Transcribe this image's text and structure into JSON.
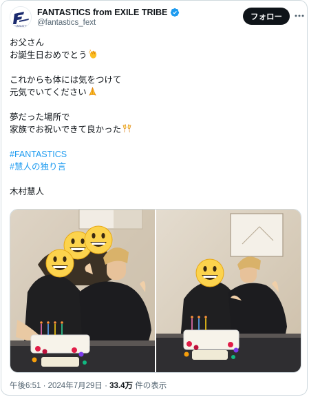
{
  "tweet": {
    "author": {
      "display_name": "FANTASTICS from EXILE TRIBE",
      "handle": "@fantastics_fext",
      "avatar_icon": "fantastics-logo-icon",
      "verified_icon": "verified-badge-icon",
      "verified_color": "#1d9bf0"
    },
    "follow_label": "フォロー",
    "more_icon": "more-dots-icon",
    "text": {
      "line1": "お父さん",
      "line2": "お誕生日おめでとう",
      "line2_emoji": "clapping-hands-icon",
      "line3": "これからも体には気をつけて",
      "line4": "元気でいてください",
      "line4_emoji": "folded-hands-icon",
      "line5": "夢だった場所で",
      "line6": "家族でお祝いできて良かった",
      "line6_emoji": "clinking-glasses-icon",
      "hashtag1": "#FANTASTICS",
      "hashtag2": "#慧人の独り言",
      "signature": "木村慧人"
    },
    "media": {
      "photo1_icon": "family-dinner-photo",
      "photo2_icon": "birthday-cake-photo",
      "face_cover_icon": "grinning-face-icon"
    },
    "meta": {
      "time": "午後6:51",
      "separator": " · ",
      "date": "2024年7月29日",
      "views_count": "33.4万",
      "views_label": " 件の表示"
    },
    "colors": {
      "text": "#0f1419",
      "secondary": "#536471",
      "link": "#1d9bf0",
      "border": "#cfd9de"
    }
  }
}
